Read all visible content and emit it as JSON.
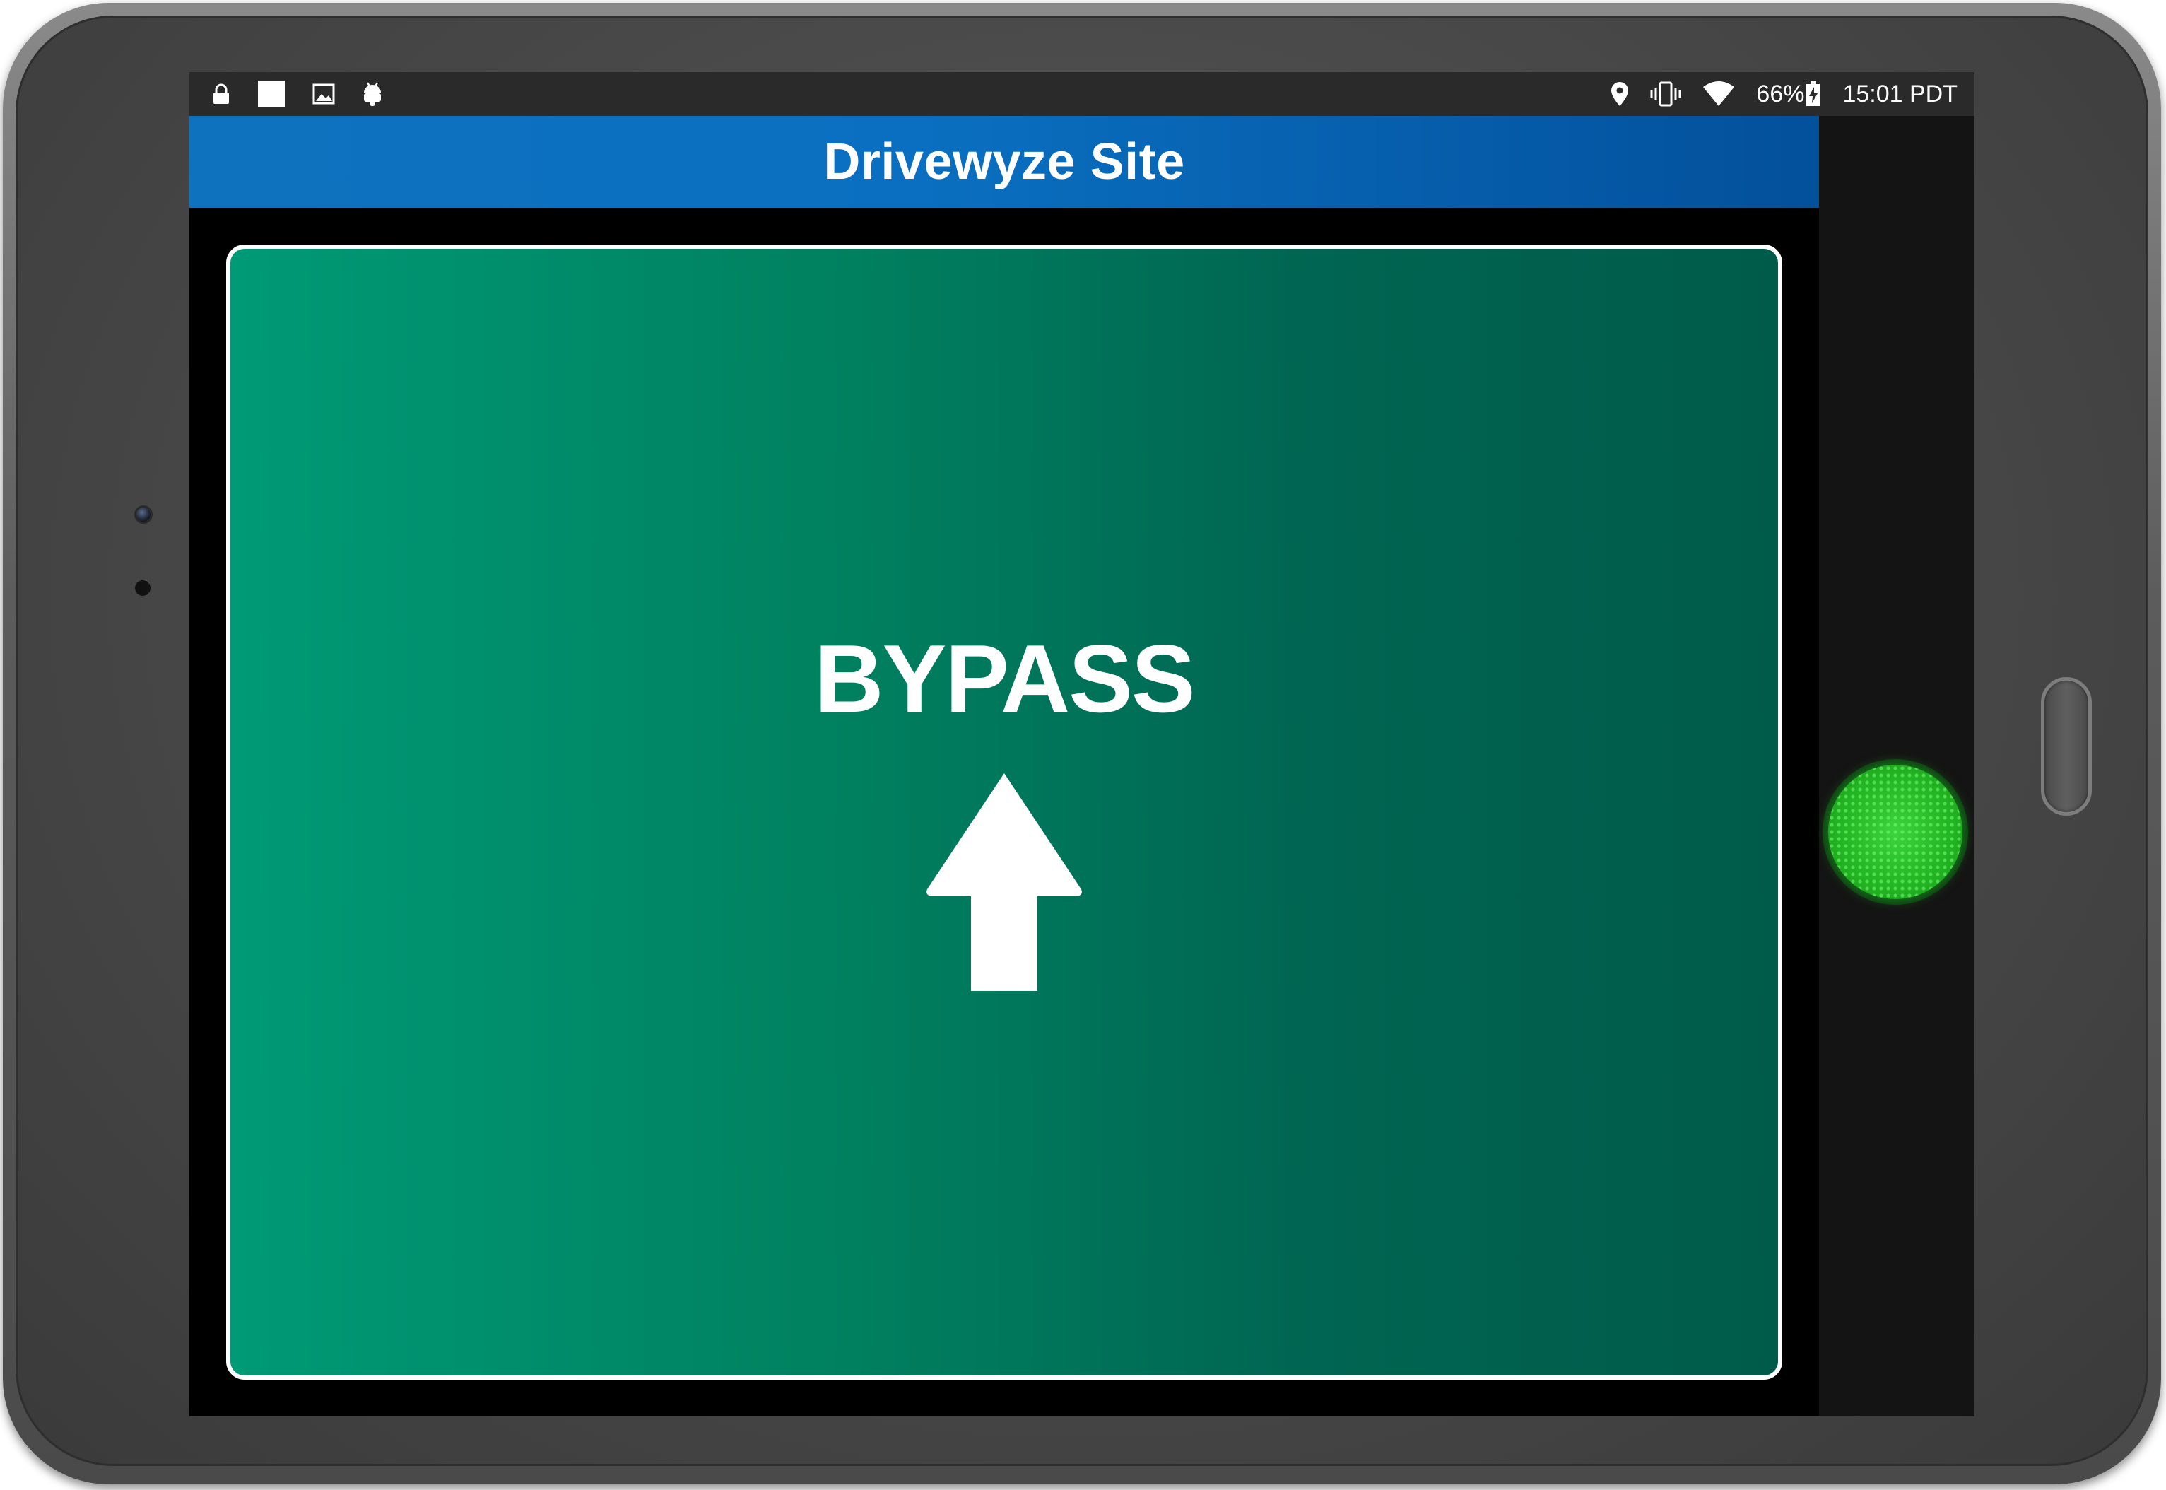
{
  "status_bar": {
    "left_icons": [
      "lock-icon",
      "notification-square-icon",
      "image-icon",
      "android-icon"
    ],
    "right_icons": [
      "location-pin-icon",
      "vibrate-icon",
      "wifi-icon",
      "battery-charging-icon"
    ],
    "battery_level": "66%",
    "clock": "15:01 PDT"
  },
  "app": {
    "title": "Drivewyze Site"
  },
  "sign": {
    "text": "BYPASS",
    "arrow_icon": "arrow-up-icon",
    "color": "#008a68"
  },
  "indicator": {
    "status_icon": "green-light-icon",
    "color": "#2ec42e"
  },
  "colors": {
    "header_blue": "#0a6fc0",
    "status_bar": "#2a2a2a",
    "device_frame": "#4a4a4a"
  }
}
